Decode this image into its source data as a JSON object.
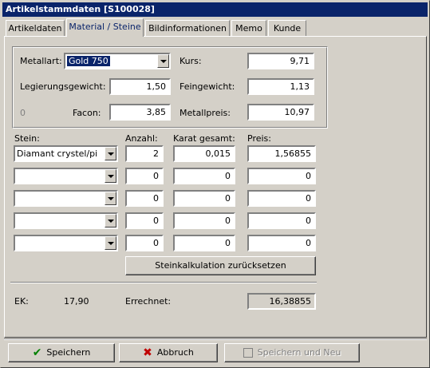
{
  "window": {
    "title": "Artikelstammdaten [S100028]"
  },
  "tabs": [
    "Artikeldaten",
    "Material / Steine",
    "Bildinformationen",
    "Memo",
    "Kunde"
  ],
  "material": {
    "metallart_label": "Metallart:",
    "metallart_value": "Gold 750",
    "kurs_label": "Kurs:",
    "kurs_value": "9,71",
    "legierungsgewicht_label": "Legierungsgewicht:",
    "legierungsgewicht_value": "1,50",
    "feingewicht_label": "Feingewicht:",
    "feingewicht_value": "1,13",
    "zero_label": "0",
    "facon_label": "Facon:",
    "facon_value": "3,85",
    "metallpreis_label": "Metallpreis:",
    "metallpreis_value": "10,97"
  },
  "stones": {
    "headers": {
      "stein": "Stein:",
      "anzahl": "Anzahl:",
      "karat": "Karat gesamt:",
      "preis": "Preis:"
    },
    "rows": [
      {
        "stein": "Diamant crystel/pi",
        "anzahl": "2",
        "karat": "0,015",
        "preis": "1,56855"
      },
      {
        "stein": "",
        "anzahl": "0",
        "karat": "0",
        "preis": "0"
      },
      {
        "stein": "",
        "anzahl": "0",
        "karat": "0",
        "preis": "0"
      },
      {
        "stein": "",
        "anzahl": "0",
        "karat": "0",
        "preis": "0"
      },
      {
        "stein": "",
        "anzahl": "0",
        "karat": "0",
        "preis": "0"
      }
    ],
    "reset_button": "Steinkalkulation zurücksetzen"
  },
  "summary": {
    "ek_label": "EK:",
    "ek_value": "17,90",
    "errechnet_label": "Errechnet:",
    "errechnet_value": "16,38855"
  },
  "footer": {
    "save": "Speichern",
    "cancel": "Abbruch",
    "save_new": "Speichern und Neu"
  },
  "icons": {
    "save": "checkmark-icon",
    "cancel": "cross-icon",
    "save_new": "disk-icon"
  }
}
